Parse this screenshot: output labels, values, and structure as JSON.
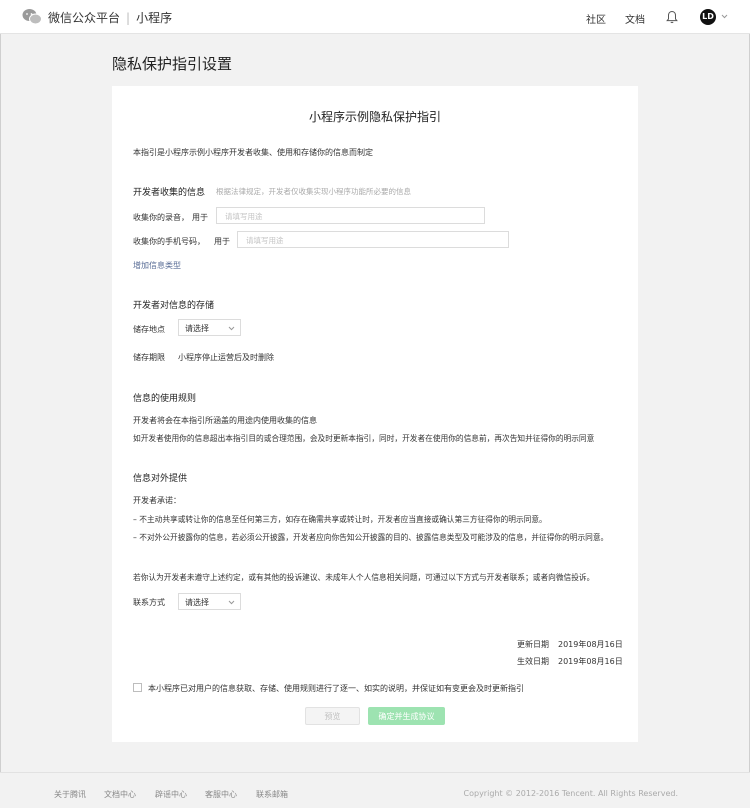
{
  "header": {
    "brand": "微信公众平台",
    "product": "小程序",
    "nav": [
      "社区",
      "文档"
    ],
    "icons": [
      "wechat-logo-icon",
      "bell-icon",
      "chevron-down-icon"
    ],
    "avatar_text": "LD"
  },
  "page_title": "隐私保护指引设置",
  "doc": {
    "title": "小程序示例隐私保护指引",
    "intro": "本指引是小程序示例小程序开发者收集、使用和存储你的信息而制定",
    "collect": {
      "heading": "开发者收集的信息",
      "hint": "根据法律规定，开发者仅收集实现小程序功能所必要的信息",
      "rows": [
        {
          "label": "收集你的录音，",
          "for": "用于",
          "placeholder": "请填写用途"
        },
        {
          "label": "收集你的手机号码，",
          "for": "用于",
          "placeholder": "请填写用途"
        }
      ],
      "add_link": "增加信息类型"
    },
    "storage": {
      "heading": "开发者对信息的存储",
      "location_label": "储存地点",
      "location_value": "请选择",
      "period_label": "储存期限",
      "period_value": "小程序停止运营后及时删除"
    },
    "usage": {
      "heading": "信息的使用规则",
      "line1": "开发者将会在本指引所涵盖的用途内使用收集的信息",
      "line2": "如开发者使用你的信息超出本指引目的或合理范围，会及时更新本指引，同时，开发者在使用你的信息前，再次告知并征得你的明示同意"
    },
    "provide": {
      "heading": "信息对外提供",
      "promise": "开发者承诺：",
      "item1": "–  不主动共享或转让你的信息至任何第三方，如存在确需共享或转让时，开发者应当直接或确认第三方征得你的明示同意。",
      "item2": "–  不对外公开披露你的信息，若必须公开披露，开发者应向你告知公开披露的目的、披露信息类型及可能涉及的信息，并征得你的明示同意。"
    },
    "complaint": "若你认为开发者未遵守上述约定，或有其他的投诉建议、未成年人个人信息相关问题，可通过以下方式与开发者联系；或者向微信投诉。",
    "contact_label": "联系方式",
    "contact_value": "请选择",
    "update_label": "更新日期",
    "update_date": "2019年08月16日",
    "effective_label": "生效日期",
    "effective_date": "2019年08月16日",
    "agree_text": "本小程序已对用户的信息获取、存储、使用规则进行了逐一、如实的说明，并保证如有变更会及时更新指引",
    "preview_button": "预览",
    "generate_button": "确定并生成协议"
  },
  "footer": {
    "links": [
      "关于腾讯",
      "文档中心",
      "辟谣中心",
      "客服中心",
      "联系邮箱"
    ],
    "copyright": "Copyright © 2012-2016 Tencent. All Rights Reserved."
  }
}
